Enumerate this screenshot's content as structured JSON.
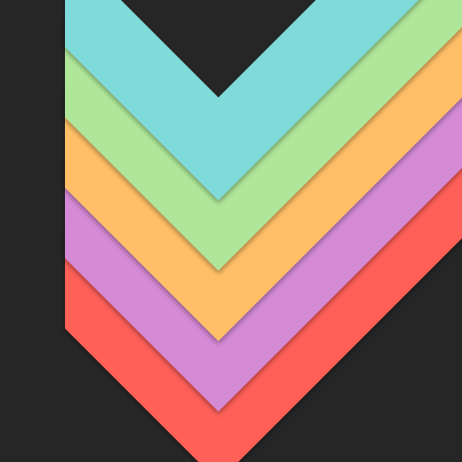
{
  "background_color": "#262626",
  "bands": [
    {
      "name": "red-chevron-band",
      "color": "#FF6058"
    },
    {
      "name": "purple-chevron-band",
      "color": "#D58AD6"
    },
    {
      "name": "orange-chevron-band",
      "color": "#FFBF66"
    },
    {
      "name": "green-chevron-band",
      "color": "#B0E69A"
    },
    {
      "name": "cyan-chevron-band",
      "color": "#7EDBDA"
    }
  ]
}
